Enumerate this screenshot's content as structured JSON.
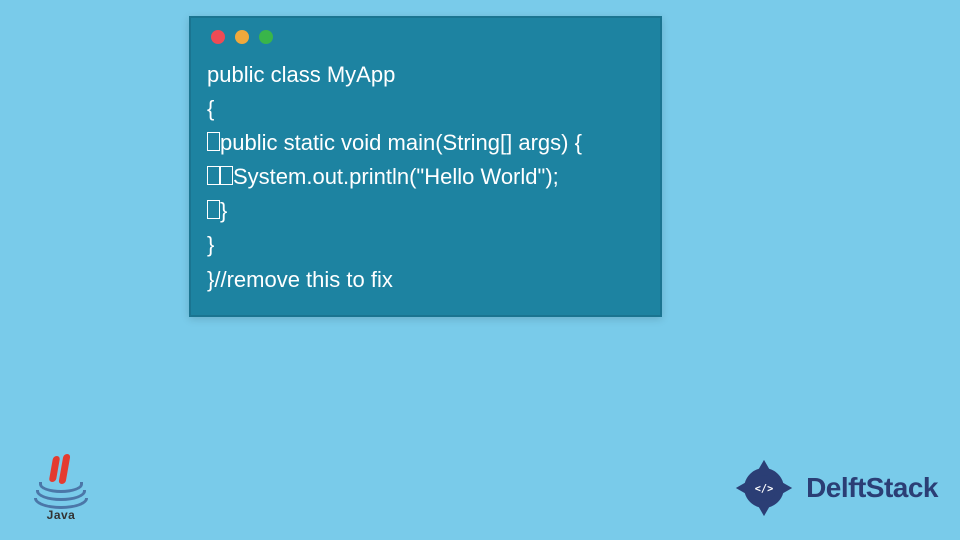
{
  "window": {
    "traffic_lights": [
      "red",
      "yellow",
      "green"
    ]
  },
  "code": {
    "lines": [
      {
        "indent": 0,
        "text": "public class MyApp"
      },
      {
        "indent": 0,
        "text": "{"
      },
      {
        "indent": 1,
        "text": "public static void main(String[] args) {"
      },
      {
        "indent": 2,
        "text": "System.out.println(\"Hello World\");"
      },
      {
        "indent": 1,
        "text": "}"
      },
      {
        "indent": 0,
        "text": "}"
      },
      {
        "indent": 0,
        "text": "}//remove this to fix"
      }
    ]
  },
  "logos": {
    "java_label": "Java",
    "brand_text": "DelftStack"
  },
  "colors": {
    "page_bg": "#79cbea",
    "window_bg": "#1d83a1",
    "code_fg": "#ffffff",
    "brand": "#2b3e75"
  }
}
